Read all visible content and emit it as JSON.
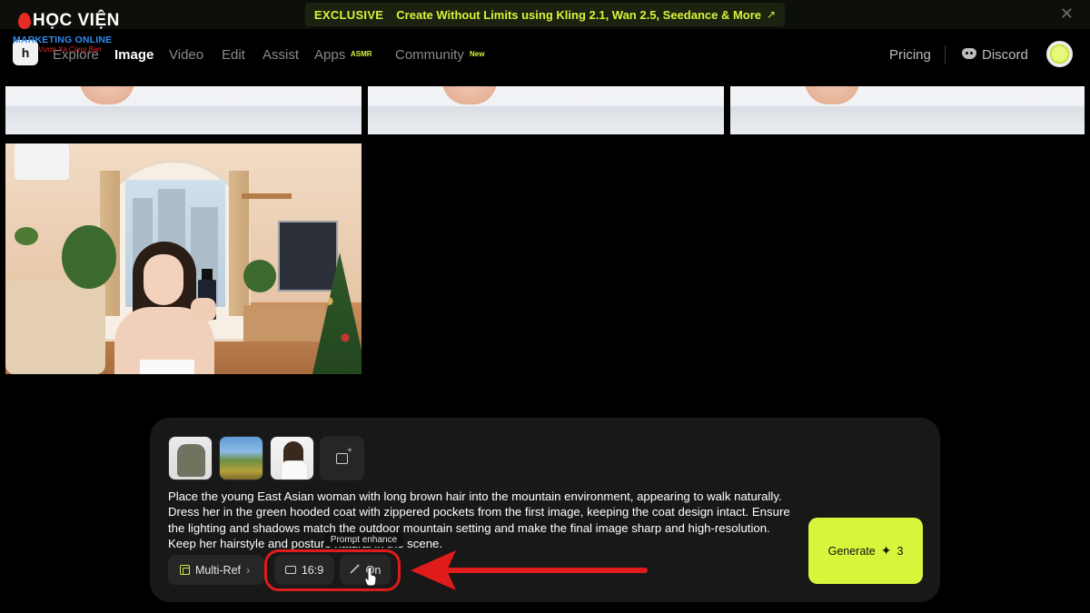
{
  "banner": {
    "tag": "EXCLUSIVE",
    "text": "Create Without Limits using Kling 2.1, Wan 2.5, Seedance & More",
    "arrow": "↗",
    "close": "✕"
  },
  "watermark": {
    "title": "HỌC VIỆN",
    "subtitle": "MARKETING ONLINE",
    "slogan": "Vươn Xa Cùng Bạn"
  },
  "nav": {
    "logo": "h",
    "items": [
      {
        "label": "Explore"
      },
      {
        "label": "Image"
      },
      {
        "label": "Video"
      },
      {
        "label": "Edit"
      },
      {
        "label": "Assist"
      },
      {
        "label": "Apps"
      },
      {
        "label": "Community"
      }
    ],
    "apps_badge": "ASMR",
    "community_badge": "New",
    "pricing": "Pricing",
    "discord": "Discord",
    "active": "Image"
  },
  "composer": {
    "references": [
      "green hooded coat",
      "mountain landscape",
      "young woman"
    ],
    "prompt": "Place the young East Asian woman with long brown hair into the mountain environment, appearing to walk naturally. Dress her in the green hooded coat with zippered pockets from the first image, keeping the coat design intact. Ensure the lighting and shadows match the outdoor mountain setting and make the final image sharp and high-resolution. Keep her hairstyle and posture natural in the scene.",
    "tooltip": "Prompt enhance",
    "multiref_label": "Multi-Ref",
    "chevron": "›",
    "ratio_label": "16:9",
    "enhance_label": "On",
    "wand": "⁄",
    "generate_label": "Generate",
    "generate_sparkle": "✦",
    "generate_count": "3"
  },
  "colors": {
    "accent": "#d8f53b",
    "annotation": "#e01b1b",
    "panel": "#181818",
    "chip": "#262626"
  },
  "icons": [
    "close-icon",
    "discord-icon",
    "add-image-icon",
    "multiref-icon",
    "aspect-ratio-icon",
    "magic-wand-icon",
    "sparkle-icon",
    "chevron-right-icon",
    "hand-cursor-icon"
  ]
}
